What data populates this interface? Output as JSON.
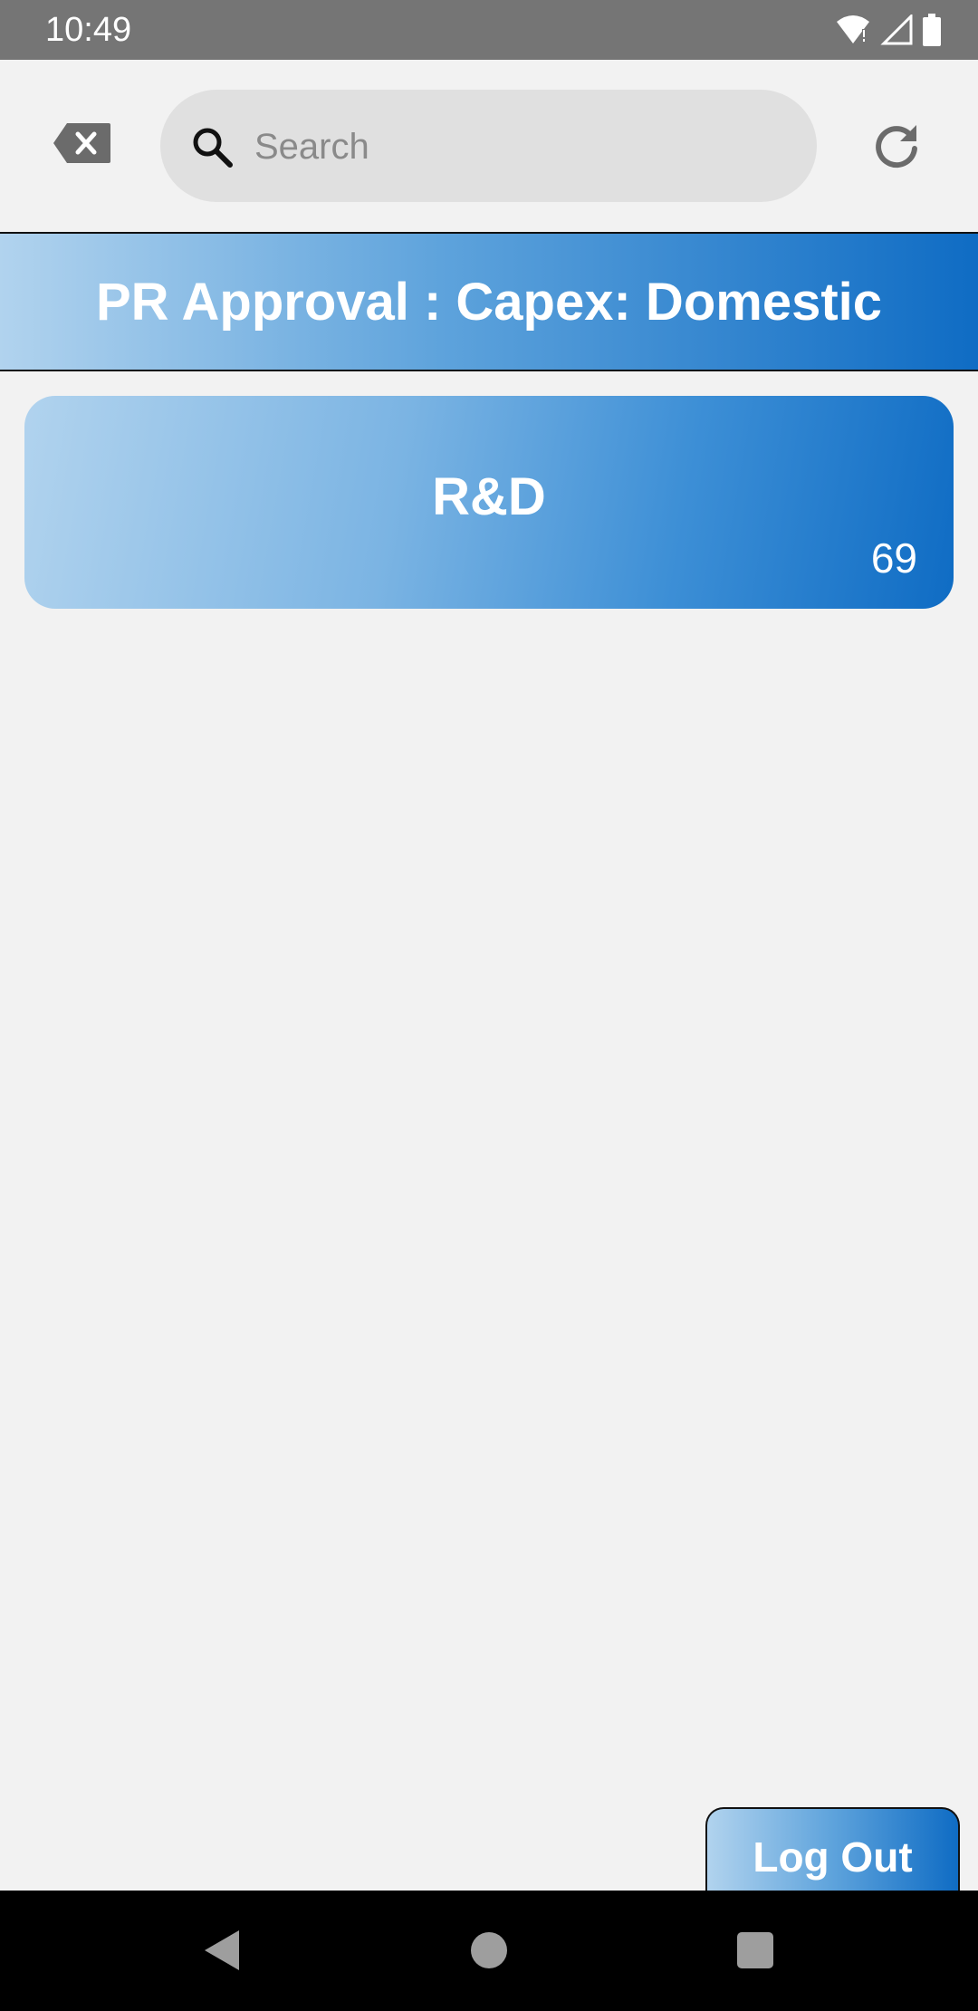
{
  "status_bar": {
    "time": "10:49"
  },
  "toolbar": {
    "search_placeholder": "Search",
    "search_value": ""
  },
  "header": {
    "title": "PR Approval : Capex: Domestic"
  },
  "list": {
    "items": [
      {
        "name": "R&D",
        "count": "69"
      }
    ]
  },
  "footer": {
    "logout_label": "Log Out"
  },
  "colors": {
    "gradient_start": "#b1d3ee",
    "gradient_end": "#0f6cc4",
    "background": "#f2f2f2",
    "search_bg": "#e0e0e0"
  },
  "icons": {
    "clear": "backspace-clear-icon",
    "search": "search-icon",
    "refresh": "refresh-icon"
  }
}
